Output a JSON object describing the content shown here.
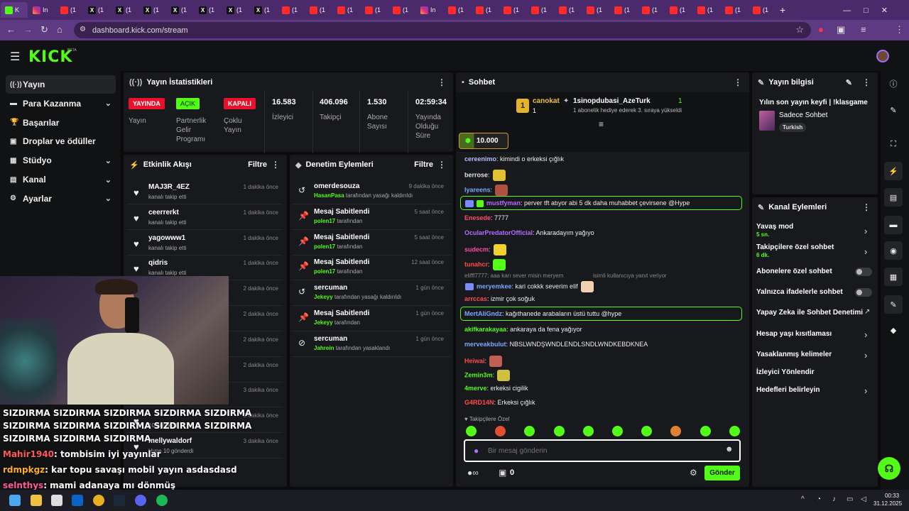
{
  "browser": {
    "tabs": [
      {
        "icon": "kick",
        "label": "K"
      },
      {
        "icon": "instagram",
        "label": "In"
      },
      {
        "icon": "youtube",
        "label": "(1"
      },
      {
        "icon": "x",
        "label": "(1"
      },
      {
        "icon": "x",
        "label": "(1"
      },
      {
        "icon": "x",
        "label": "(1"
      },
      {
        "icon": "x",
        "label": "(1"
      },
      {
        "icon": "x",
        "label": "(1"
      },
      {
        "icon": "x",
        "label": "(1"
      },
      {
        "icon": "x",
        "label": "(1"
      },
      {
        "icon": "youtube",
        "label": "(1"
      },
      {
        "icon": "youtube",
        "label": "(1"
      },
      {
        "icon": "youtube",
        "label": "(1"
      },
      {
        "icon": "youtube",
        "label": "(1"
      },
      {
        "icon": "youtube",
        "label": "(1"
      },
      {
        "icon": "instagram",
        "label": "In"
      },
      {
        "icon": "youtube",
        "label": "(1"
      },
      {
        "icon": "youtube",
        "label": "(1"
      },
      {
        "icon": "youtube",
        "label": "(1"
      },
      {
        "icon": "youtube",
        "label": "(1"
      },
      {
        "icon": "youtube",
        "label": "(1"
      },
      {
        "icon": "youtube",
        "label": "(1"
      },
      {
        "icon": "youtube",
        "label": "(1"
      },
      {
        "icon": "youtube",
        "label": "(1"
      },
      {
        "icon": "youtube",
        "label": "(1"
      },
      {
        "icon": "youtube",
        "label": "(1"
      },
      {
        "icon": "youtube",
        "label": "(1"
      },
      {
        "icon": "youtube",
        "label": "(1"
      }
    ],
    "url": "dashboard.kick.com/stream"
  },
  "header": {
    "logo": "KICK",
    "beta": "BETA"
  },
  "sidebar": {
    "items": [
      {
        "label": "Yayın",
        "icon": "broadcast-icon",
        "chev": false
      },
      {
        "label": "Para Kazanma",
        "icon": "money-icon",
        "chev": true
      },
      {
        "label": "Başarılar",
        "icon": "trophy-icon",
        "chev": false
      },
      {
        "label": "Droplar ve ödüller",
        "icon": "gift-icon",
        "chev": false
      },
      {
        "label": "Stüdyo",
        "icon": "studio-icon",
        "chev": true
      },
      {
        "label": "Kanal",
        "icon": "channel-icon",
        "chev": true
      },
      {
        "label": "Ayarlar",
        "icon": "gear-icon",
        "chev": true
      }
    ]
  },
  "stats": {
    "title": "Yayın İstatistikleri",
    "status_badge": "YAYINDA",
    "status_label": "Yayın",
    "partner_badge": "AÇIK",
    "partner_label": "Partnerlik Gelir Programı",
    "multi_badge": "KAPALI",
    "multi_label": "Çoklu Yayın",
    "viewers": "16.583",
    "viewers_label": "İzleyici",
    "followers": "406.096",
    "followers_label": "Takipçi",
    "subs": "1.530",
    "subs_label": "Abone Sayısı",
    "uptime": "02:59:34",
    "uptime_label": "Yayında Olduğu Süre"
  },
  "activity": {
    "title": "Etkinlik Akışı",
    "filter": "Filtre",
    "rows": [
      {
        "name": "MAJ3R_4EZ",
        "sub": "kanalı takip etti",
        "time": "1 dakika önce"
      },
      {
        "name": "ceerrerkt",
        "sub": "kanalı takip etti",
        "time": "1 dakika önce"
      },
      {
        "name": "yagowww1",
        "sub": "kanalı takip etti",
        "time": "1 dakika önce"
      },
      {
        "name": "qidris",
        "sub": "kanalı takip etti",
        "time": "1 dakika önce"
      },
      {
        "name": "",
        "sub": "",
        "time": "2 dakika önce"
      },
      {
        "name": "",
        "sub": "",
        "time": "2 dakika önce"
      },
      {
        "name": "",
        "sub": "",
        "time": "2 dakika önce"
      },
      {
        "name": "",
        "sub": "",
        "time": "2 dakika önce"
      },
      {
        "name": "",
        "sub": "",
        "time": "3 dakika önce"
      },
      {
        "name": "",
        "sub": "10 gönderdi",
        "time": "3 dakika önce"
      },
      {
        "name": "mellywaldorf",
        "sub": "Hype 10 gönderdi",
        "time": "3 dakika önce"
      }
    ]
  },
  "moderation": {
    "title": "Denetim Eylemleri",
    "filter": "Filtre",
    "rows": [
      {
        "icon": "unban-icon",
        "name": "omerdesouza",
        "who": "HasanPasa",
        "sub": " tarafından yasağı kaldırıldı",
        "time": "9 dakika önce"
      },
      {
        "icon": "pin-icon",
        "name": "Mesaj Sabitlendi",
        "who": "polen17",
        "sub": " tarafından",
        "time": "5 saat önce"
      },
      {
        "icon": "pin-icon",
        "name": "Mesaj Sabitlendi",
        "who": "polen17",
        "sub": " tarafından",
        "time": "5 saat önce"
      },
      {
        "icon": "pin-icon",
        "name": "Mesaj Sabitlendi",
        "who": "polen17",
        "sub": " tarafından",
        "time": "12 saat önce"
      },
      {
        "icon": "unban-icon",
        "name": "sercuman",
        "who": "Jekeyy",
        "sub": " tarafından yasağı kaldırıldı",
        "time": "1 gün önce"
      },
      {
        "icon": "pin-icon",
        "name": "Mesaj Sabitlendi",
        "who": "Jekeyy",
        "sub": " tarafından",
        "time": "1 gün önce"
      },
      {
        "icon": "ban-icon",
        "name": "sercuman",
        "who": "Jahrein",
        "sub": " tarafından yasaklandı",
        "time": "1 gün önce"
      }
    ]
  },
  "chat": {
    "title": "Sohbet",
    "top_gifter": "canokat",
    "top_gifter_count": "1",
    "gift_user": "1sinopdubasi_AzeTurk",
    "gift_count": "1",
    "gift_text": "1 abonelik hediye ederek 3. sıraya yükseldi",
    "goal": "10.000",
    "messages": [
      {
        "user": "cereenimo",
        "color": "#b8b8ff",
        "text": ": kimindi o erkeksi çığlık"
      },
      {
        "user": "berrose",
        "color": "#e0e0e0",
        "text": ":"
      },
      {
        "user": "lyareens",
        "color": "#7aa8ff",
        "text": ":"
      },
      {
        "user": "mustfyman",
        "color": "#b26bff",
        "text": ": perver tft atıyor abi 5 dk daha muhabbet çevirsene @Hype"
      },
      {
        "user": "Enesede",
        "color": "#ff4d6d",
        "text": ": 7777"
      },
      {
        "user": "OcularPredatorOfficial",
        "color": "#b26bff",
        "text": ": Ankaradayım yağıyo"
      },
      {
        "user": "sudecm",
        "color": "#ff4d9e",
        "text": ":"
      },
      {
        "user": "tunahcr",
        "color": "#ff4d4d",
        "text": ":"
      },
      {
        "user": "meryemkee",
        "color": "#7aa8ff",
        "text": ": kari cokkk severim elif"
      },
      {
        "user": "arrccas",
        "color": "#ff4d4d",
        "text": ": izmir çok soğuk"
      },
      {
        "user": "MertAliGndz",
        "color": "#7aa8ff",
        "text": ": kağıthanede arabaların üstü tuttu @hype"
      },
      {
        "user": "akifkarakayaa",
        "color": "#53fc18",
        "text": ": ankaraya da fena yağıyor"
      },
      {
        "user": "merveakbulut",
        "color": "#7aa8ff",
        "text": ": NBSLWNDŞWNDLENDLSNDLWNDKEBDKNEA"
      },
      {
        "user": "Heiwai",
        "color": "#ff4d4d",
        "text": ":"
      },
      {
        "user": "Zemin3m",
        "color": "#53fc18",
        "text": ":"
      },
      {
        "user": "4merve",
        "color": "#53fc18",
        "text": ": erkeksi cigilik"
      },
      {
        "user": "G4RD14N",
        "color": "#ff4d4d",
        "text": ": Erkeksi çığlık"
      }
    ],
    "reply_hint": "elifff7777: aaa karı sever misin meryem",
    "reply_hint2": "isimli kullanıcıya yanıt veriyor",
    "followers_only": "Takipçilere Özel",
    "placeholder": "Bir mesaj gönderin",
    "points": "0",
    "send": "Gönder"
  },
  "stream_info": {
    "title": "Yayın bilgisi",
    "stream_title": "Yılın son yayın keyfi | !klasgame",
    "category": "Sadece Sohbet",
    "tag": "Turkish"
  },
  "channel_actions": {
    "title": "Kanal Eylemleri",
    "items": [
      {
        "label": "Yavaş mod",
        "sub": "5 sn.",
        "type": "chev"
      },
      {
        "label": "Takipçilere özel sohbet",
        "sub": "6 dk.",
        "type": "chev"
      },
      {
        "label": "Abonelere özel sohbet",
        "sub": "",
        "type": "toggle"
      },
      {
        "label": "Yalnızca ifadelerle sohbet",
        "sub": "",
        "type": "toggle"
      },
      {
        "label": "Yapay Zeka ile Sohbet Denetimi",
        "sub": "",
        "type": "ext"
      },
      {
        "label": "Hesap yaşı kısıtlaması",
        "sub": "",
        "type": "chev"
      },
      {
        "label": "Yasaklanmış kelimeler",
        "sub": "",
        "type": "chev"
      },
      {
        "label": "İzleyici Yönlendir",
        "sub": "",
        "type": "none"
      },
      {
        "label": "Hedefleri belirleyin",
        "sub": "",
        "type": "chev"
      }
    ]
  },
  "overlay": {
    "lines": [
      "SIZDIRMA SIZDIRMA SIZDIRMA SIZDIRMA SIZDIRMA",
      "SIZDIRMA SIZDIRMA SIZDIRMA SIZDIRMA SIZDIRMA",
      "SIZDIRMA SIZDIRMA SIZDIRMA"
    ],
    "chat": [
      {
        "user": "Mahir1940",
        "color": "#ff5a5a",
        "text": ": tombisim iyi yayınlar"
      },
      {
        "user": "rdmpkgz",
        "color": "#ffb020",
        "text": ": kar topu savaşı mobil yayın asdasdasd"
      },
      {
        "user": "selnthys",
        "color": "#ff5a9a",
        "text": ": mami adanaya mı dönmüş"
      }
    ]
  },
  "taskbar": {
    "time": "00:33",
    "date": "31.12.2025"
  }
}
